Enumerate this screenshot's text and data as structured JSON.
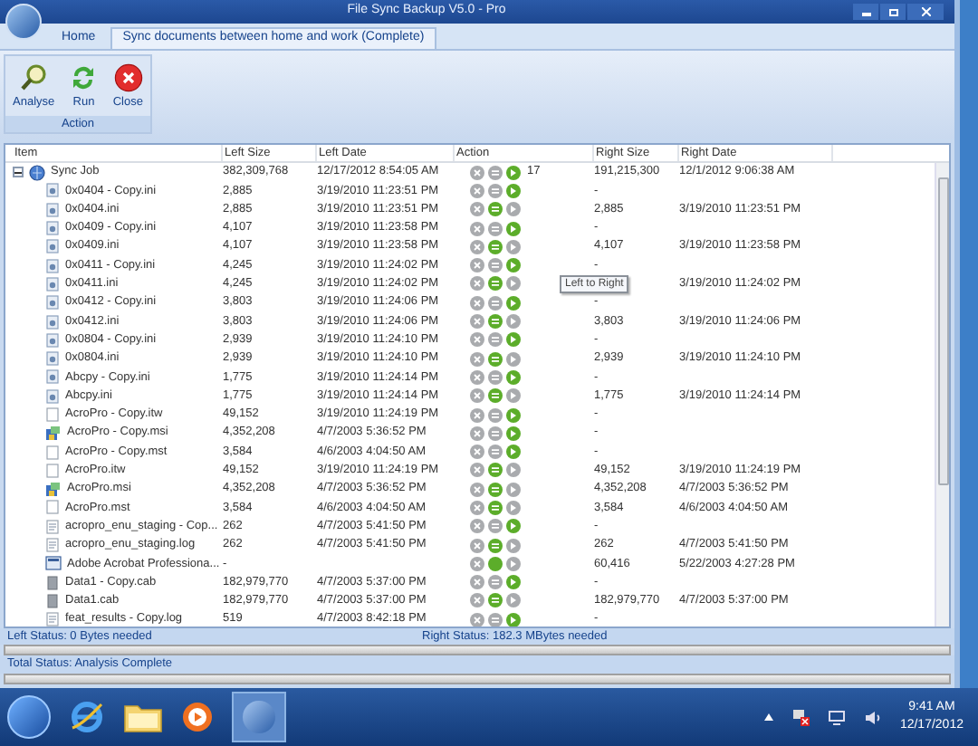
{
  "window": {
    "title": "File Sync Backup V5.0 - Pro"
  },
  "tabs": [
    {
      "label": "Home",
      "selected": false
    },
    {
      "label": "Sync documents between home and work (Complete)",
      "selected": true
    }
  ],
  "ribbon": {
    "group": "Action",
    "buttons": [
      {
        "label": "Analyse",
        "kind": "analyse"
      },
      {
        "label": "Run",
        "kind": "run"
      },
      {
        "label": "Close",
        "kind": "close"
      }
    ]
  },
  "table": {
    "columns": [
      "Item",
      "Left Size",
      "Left Date",
      "Action",
      "Right Size",
      "Right Date"
    ],
    "root": {
      "name": "Sync Job",
      "expanded": true,
      "left_size": "382,309,768",
      "left_date": "12/17/2012 8:54:05 AM",
      "equal": false,
      "to_left": false,
      "to_right": true,
      "count": "17",
      "right_size": "191,215,300",
      "right_date": "12/1/2012 9:06:38 AM",
      "children": [
        {
          "name": "0x0404 - Copy.ini",
          "kind": "ini",
          "left_size": "2,885",
          "left_date": "3/19/2010 11:23:51 PM",
          "equal": false,
          "to_left": false,
          "to_right": true,
          "right_size": "-"
        },
        {
          "name": "0x0404.ini",
          "kind": "ini",
          "left_size": "2,885",
          "left_date": "3/19/2010 11:23:51 PM",
          "equal": true,
          "to_left": false,
          "to_right": false,
          "right_size": "2,885",
          "right_date": "3/19/2010 11:23:51 PM"
        },
        {
          "name": "0x0409 - Copy.ini",
          "kind": "ini",
          "left_size": "4,107",
          "left_date": "3/19/2010 11:23:58 PM",
          "equal": false,
          "to_left": false,
          "to_right": true,
          "right_size": "-"
        },
        {
          "name": "0x0409.ini",
          "kind": "ini",
          "left_size": "4,107",
          "left_date": "3/19/2010 11:23:58 PM",
          "equal": true,
          "to_left": false,
          "to_right": false,
          "right_size": "4,107",
          "right_date": "3/19/2010 11:23:58 PM"
        },
        {
          "name": "0x0411 - Copy.ini",
          "kind": "ini",
          "left_size": "4,245",
          "left_date": "3/19/2010 11:24:02 PM",
          "equal": false,
          "to_left": false,
          "to_right": true,
          "right_size": "-"
        },
        {
          "name": "0x0411.ini",
          "kind": "ini",
          "left_size": "4,245",
          "left_date": "3/19/2010 11:24:02 PM",
          "equal": true,
          "to_left": false,
          "to_right": false,
          "tooltip": "Left to Right",
          "right_date": "3/19/2010 11:24:02 PM"
        },
        {
          "name": "0x0412 - Copy.ini",
          "kind": "ini",
          "left_size": "3,803",
          "left_date": "3/19/2010 11:24:06 PM",
          "equal": false,
          "to_left": false,
          "to_right": true,
          "right_size": "-"
        },
        {
          "name": "0x0412.ini",
          "kind": "ini",
          "left_size": "3,803",
          "left_date": "3/19/2010 11:24:06 PM",
          "equal": true,
          "to_left": false,
          "to_right": false,
          "right_size": "3,803",
          "right_date": "3/19/2010 11:24:06 PM"
        },
        {
          "name": "0x0804 - Copy.ini",
          "kind": "ini",
          "left_size": "2,939",
          "left_date": "3/19/2010 11:24:10 PM",
          "equal": false,
          "to_left": false,
          "to_right": true,
          "right_size": "-"
        },
        {
          "name": "0x0804.ini",
          "kind": "ini",
          "left_size": "2,939",
          "left_date": "3/19/2010 11:24:10 PM",
          "equal": true,
          "to_left": false,
          "to_right": false,
          "right_size": "2,939",
          "right_date": "3/19/2010 11:24:10 PM"
        },
        {
          "name": "Abcpy - Copy.ini",
          "kind": "ini",
          "left_size": "1,775",
          "left_date": "3/19/2010 11:24:14 PM",
          "equal": false,
          "to_left": false,
          "to_right": true,
          "right_size": "-"
        },
        {
          "name": "Abcpy.ini",
          "kind": "ini",
          "left_size": "1,775",
          "left_date": "3/19/2010 11:24:14 PM",
          "equal": true,
          "to_left": false,
          "to_right": false,
          "right_size": "1,775",
          "right_date": "3/19/2010 11:24:14 PM"
        },
        {
          "name": "AcroPro - Copy.itw",
          "kind": "blank",
          "left_size": "49,152",
          "left_date": "3/19/2010 11:24:19 PM",
          "equal": false,
          "to_left": false,
          "to_right": true,
          "right_size": "-"
        },
        {
          "name": "AcroPro - Copy.msi",
          "kind": "msi",
          "left_size": "4,352,208",
          "left_date": "4/7/2003 5:36:52 PM",
          "equal": false,
          "to_left": false,
          "to_right": true,
          "right_size": "-"
        },
        {
          "name": "AcroPro - Copy.mst",
          "kind": "blank",
          "left_size": "3,584",
          "left_date": "4/6/2003 4:04:50 AM",
          "equal": false,
          "to_left": false,
          "to_right": true,
          "right_size": "-"
        },
        {
          "name": "AcroPro.itw",
          "kind": "blank",
          "left_size": "49,152",
          "left_date": "3/19/2010 11:24:19 PM",
          "equal": true,
          "to_left": false,
          "to_right": false,
          "right_size": "49,152",
          "right_date": "3/19/2010 11:24:19 PM"
        },
        {
          "name": "AcroPro.msi",
          "kind": "msi",
          "left_size": "4,352,208",
          "left_date": "4/7/2003 5:36:52 PM",
          "equal": true,
          "to_left": false,
          "to_right": false,
          "right_size": "4,352,208",
          "right_date": "4/7/2003 5:36:52 PM"
        },
        {
          "name": "AcroPro.mst",
          "kind": "blank",
          "left_size": "3,584",
          "left_date": "4/6/2003 4:04:50 AM",
          "equal": true,
          "to_left": false,
          "to_right": false,
          "right_size": "3,584",
          "right_date": "4/6/2003 4:04:50 AM"
        },
        {
          "name": "acropro_enu_staging - Cop...",
          "kind": "log",
          "left_size": "262",
          "left_date": "4/7/2003 5:41:50 PM",
          "equal": false,
          "to_left": false,
          "to_right": true,
          "right_size": "-"
        },
        {
          "name": "acropro_enu_staging.log",
          "kind": "log",
          "left_size": "262",
          "left_date": "4/7/2003 5:41:50 PM",
          "equal": true,
          "to_left": false,
          "to_right": false,
          "right_size": "262",
          "right_date": "4/7/2003 5:41:50 PM"
        },
        {
          "name": "Adobe Acrobat Professiona...",
          "kind": "setup",
          "left_size": "-",
          "equal": false,
          "to_left": true,
          "to_right": false,
          "right_size": "60,416",
          "right_date": "5/22/2003 4:27:28 PM"
        },
        {
          "name": "Data1 - Copy.cab",
          "kind": "cab",
          "left_size": "182,979,770",
          "left_date": "4/7/2003 5:37:00 PM",
          "equal": false,
          "to_left": false,
          "to_right": true,
          "right_size": "-"
        },
        {
          "name": "Data1.cab",
          "kind": "cab",
          "left_size": "182,979,770",
          "left_date": "4/7/2003 5:37:00 PM",
          "equal": true,
          "to_left": false,
          "to_right": false,
          "right_size": "182,979,770",
          "right_date": "4/7/2003 5:37:00 PM"
        },
        {
          "name": "feat_results - Copy.log",
          "kind": "log",
          "left_size": "519",
          "left_date": "4/7/2003 8:42:18 PM",
          "equal": false,
          "to_left": false,
          "to_right": true,
          "right_size": "-"
        }
      ]
    }
  },
  "status": {
    "left": "Left Status: 0 Bytes needed",
    "right": "Right Status: 182.3 MBytes needed",
    "left_progress": {
      "level": 0
    },
    "total": "Total Status: Analysis Complete",
    "total_progress": {
      "level": 0
    }
  },
  "taskbar": {
    "time": "9:41 AM",
    "date": "12/17/2012"
  }
}
